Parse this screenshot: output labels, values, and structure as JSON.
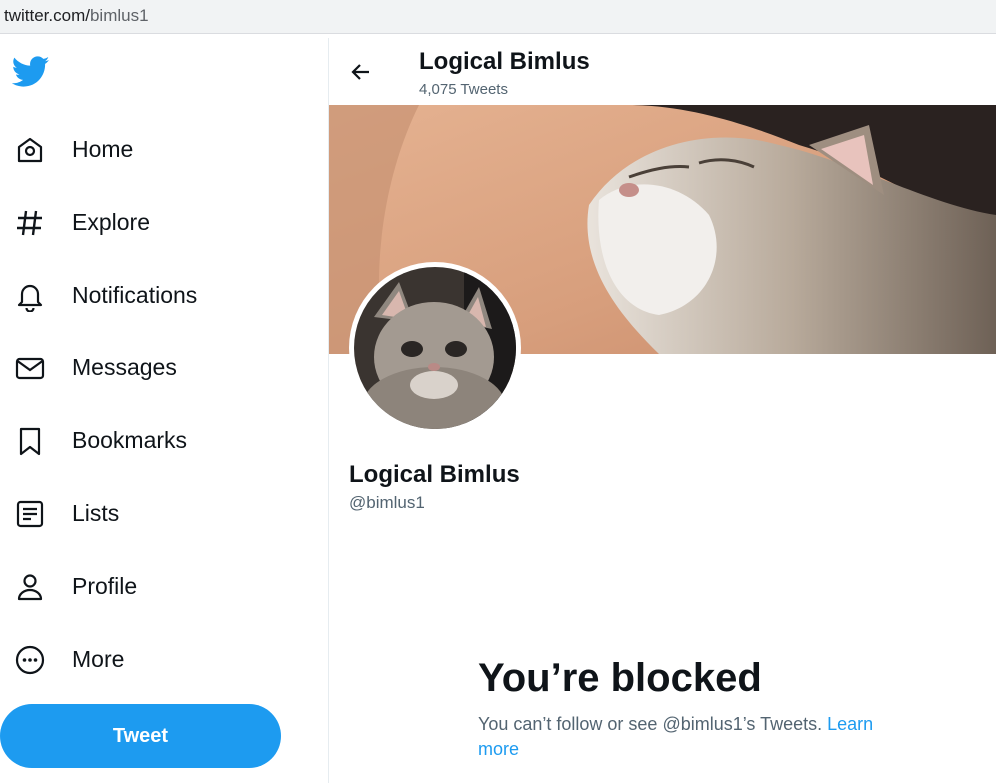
{
  "browser": {
    "url_host": "twitter.com/",
    "url_path": "bimlus1"
  },
  "logo_icon": "twitter-bird-icon",
  "nav": [
    {
      "label": "Home",
      "icon": "home-icon"
    },
    {
      "label": "Explore",
      "icon": "hashtag-icon"
    },
    {
      "label": "Notifications",
      "icon": "bell-icon"
    },
    {
      "label": "Messages",
      "icon": "envelope-icon"
    },
    {
      "label": "Bookmarks",
      "icon": "bookmark-icon"
    },
    {
      "label": "Lists",
      "icon": "list-icon"
    },
    {
      "label": "Profile",
      "icon": "person-icon"
    },
    {
      "label": "More",
      "icon": "more-circle-icon"
    }
  ],
  "tweet_button": "Tweet",
  "header": {
    "name": "Logical Bimlus",
    "tweet_count": "4,075 Tweets"
  },
  "profile": {
    "name": "Logical Bimlus",
    "handle": "@bimlus1"
  },
  "blocked": {
    "title": "You’re blocked",
    "message": "You can’t follow or see @bimlus1’s Tweets.",
    "link": "Learn more"
  },
  "colors": {
    "accent": "#1d9bf0",
    "text": "#0f1419",
    "muted": "#536471"
  }
}
